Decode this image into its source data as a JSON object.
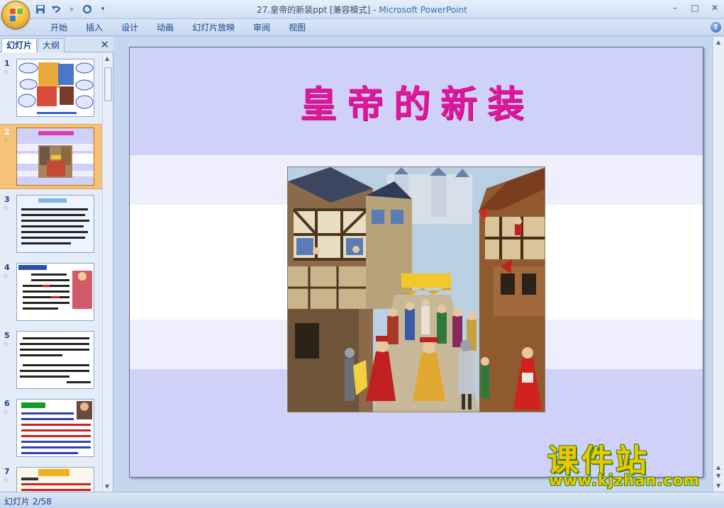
{
  "window": {
    "title": "27.皇帝的新装ppt [兼容模式] - ",
    "app_name": "Microsoft PowerPoint",
    "controls": [
      "–",
      "□",
      "✕"
    ]
  },
  "quick_access": {
    "save_icon": "save-icon",
    "undo_icon": "undo-icon",
    "redo_icon": "redo-icon",
    "customize_icon": "customize-icon"
  },
  "menu": {
    "tabs": [
      "开始",
      "插入",
      "设计",
      "动画",
      "幻灯片放映",
      "审阅",
      "视图"
    ],
    "help": "?"
  },
  "panel": {
    "tab_slides": "幻灯片",
    "tab_outline": "大纲",
    "close": "✕"
  },
  "thumbnails": [
    {
      "number": "1",
      "star": "☆"
    },
    {
      "number": "2",
      "star": "☆"
    },
    {
      "number": "3",
      "star": "☆"
    },
    {
      "number": "4",
      "star": "☆"
    },
    {
      "number": "5",
      "star": "☆"
    },
    {
      "number": "6",
      "star": "☆"
    },
    {
      "number": "7",
      "star": "☆"
    }
  ],
  "slide": {
    "title": "皇帝的新装",
    "image_alt": "medieval-street-procession-picture"
  },
  "status": {
    "slide_info": "幻灯片 2/58"
  },
  "watermark": {
    "title": "课件站",
    "url": "www.kjzhan.com"
  },
  "colors": {
    "slide_bg": "#d0d1f8",
    "title_color": "#e0169c",
    "selection": "#f5c27a",
    "watermark": "#f5c400"
  }
}
